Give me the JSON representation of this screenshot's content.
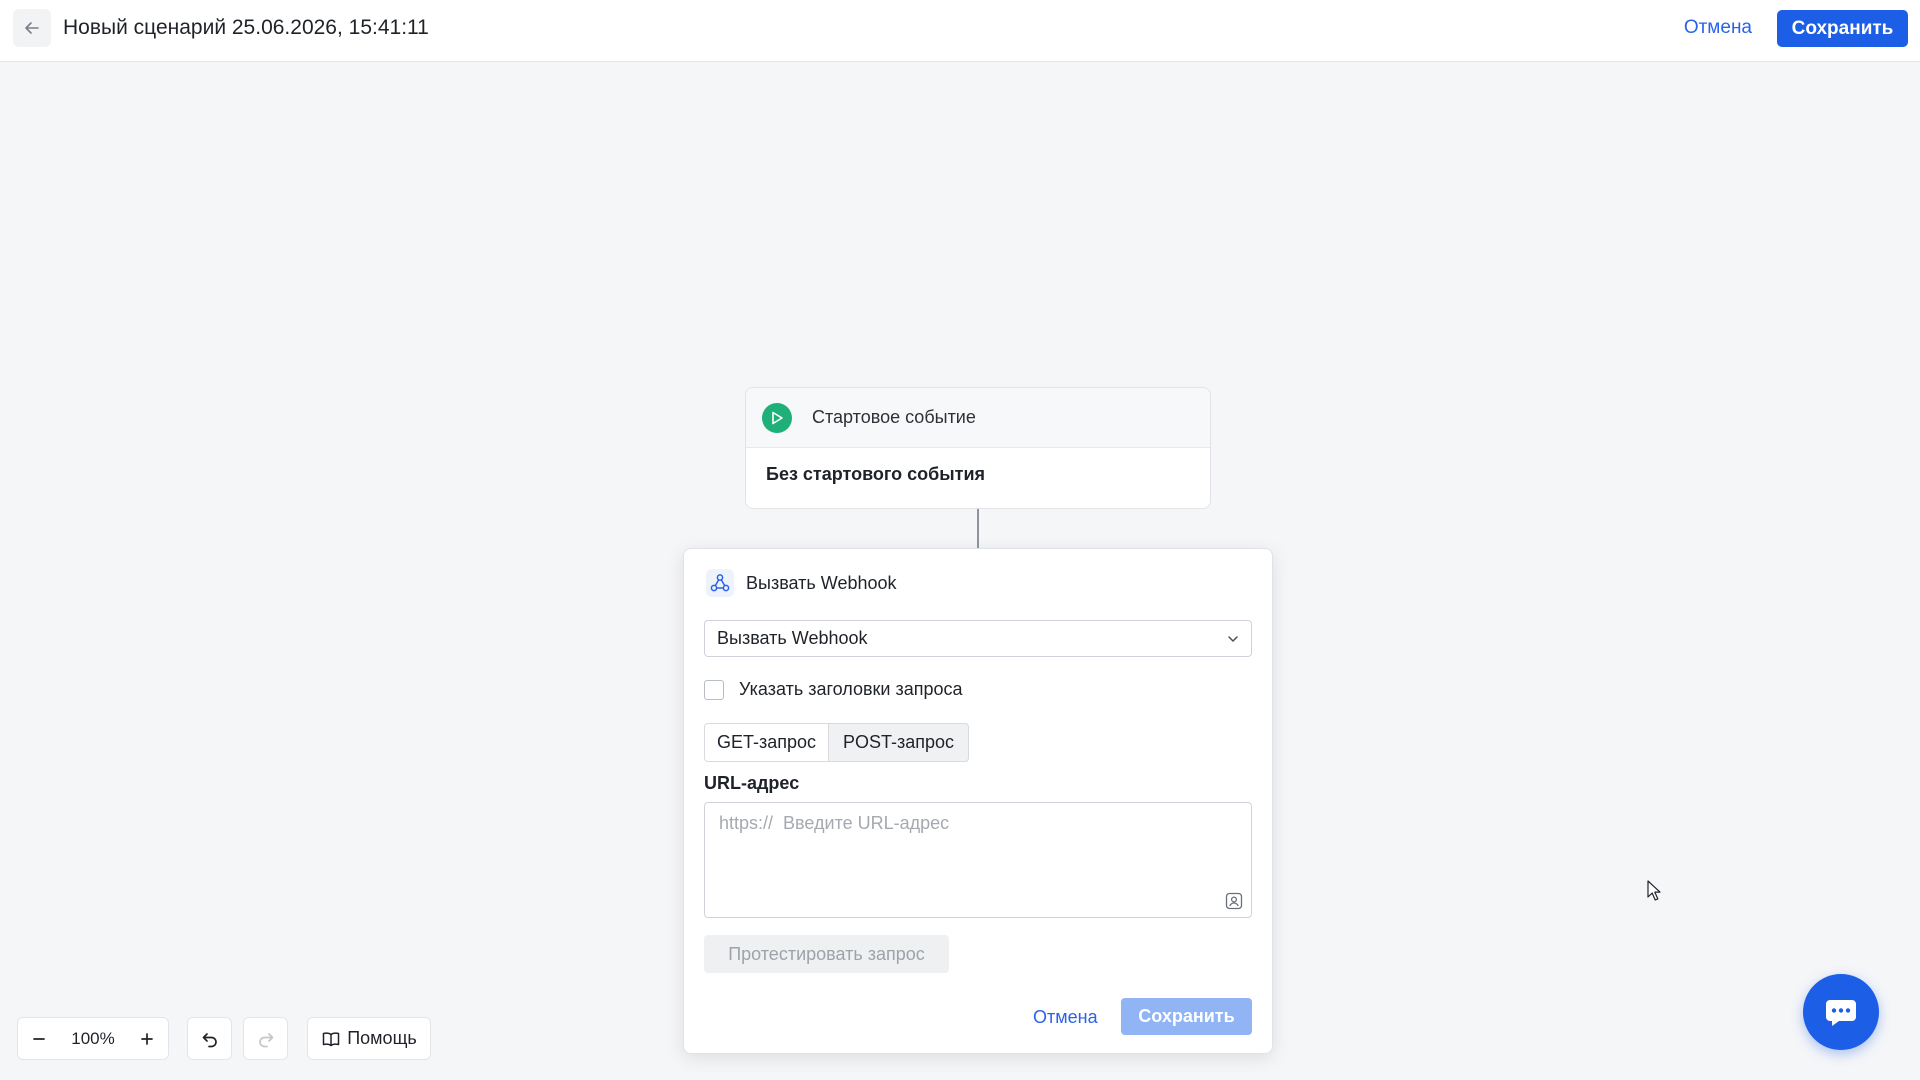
{
  "header": {
    "title": "Новый сценарий 25.06.2026, 15:41:11",
    "cancel_label": "Отмена",
    "save_label": "Сохранить"
  },
  "start_node": {
    "title": "Стартовое событие",
    "value": "Без стартового события"
  },
  "webhook_panel": {
    "title": "Вызвать Webhook",
    "action_select": "Вызвать Webhook",
    "headers_checkbox": {
      "label": "Указать заголовки запроса",
      "checked": false
    },
    "methods": [
      {
        "label": "GET-запрос",
        "active": true
      },
      {
        "label": "POST-запрос",
        "active": false
      }
    ],
    "url_label": "URL-адрес",
    "url_placeholder": "https://  Введите URL-адрес",
    "url_value": "",
    "test_label": "Протестировать запрос",
    "cancel_label": "Отмена",
    "save_label": "Сохранить"
  },
  "toolbar": {
    "zoom": "100%",
    "help_label": "Помощь"
  },
  "colors": {
    "primary": "#1c5fe6",
    "link": "#2b63e8",
    "start_icon": "#1fb07a",
    "background": "#f5f6f8"
  },
  "icons": [
    "arrow-left-icon",
    "play-icon",
    "webhook-icon",
    "chevron-down-icon",
    "variable-icon",
    "minus-icon",
    "plus-icon",
    "undo-icon",
    "redo-icon",
    "book-icon",
    "chat-icon"
  ]
}
